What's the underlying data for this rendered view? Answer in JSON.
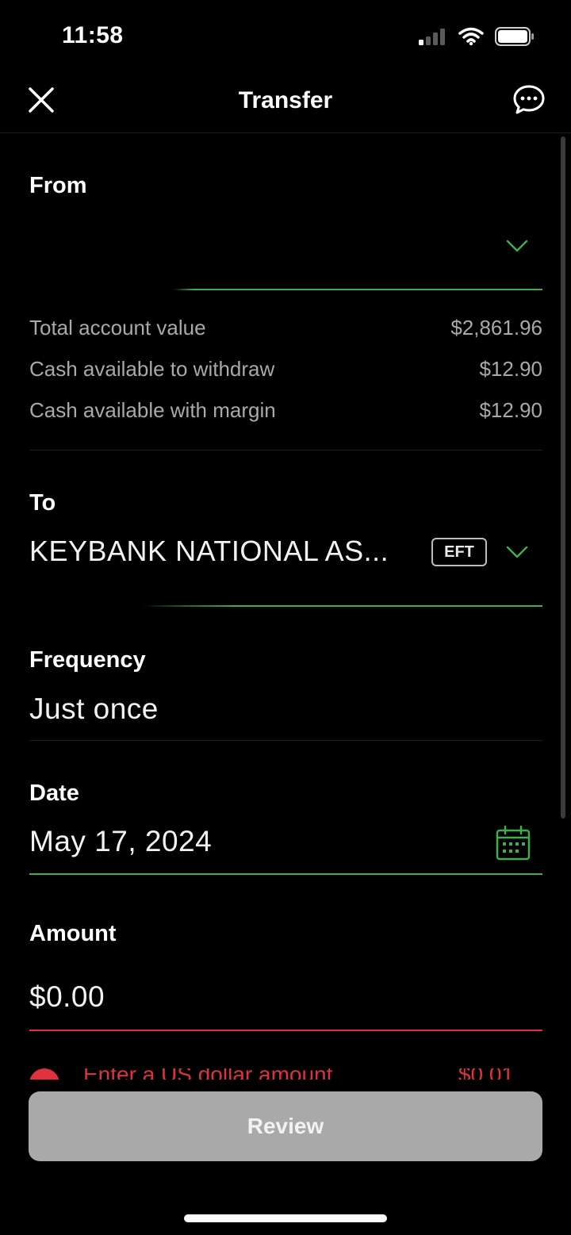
{
  "status_bar": {
    "time": "11:58"
  },
  "nav": {
    "title": "Transfer"
  },
  "from": {
    "label": "From",
    "account_value": "",
    "rows": [
      {
        "label": "Total account value",
        "value": "$2,861.96"
      },
      {
        "label": "Cash available to withdraw",
        "value": "$12.90"
      },
      {
        "label": "Cash available with margin",
        "value": "$12.90"
      }
    ]
  },
  "to": {
    "label": "To",
    "value": "KEYBANK NATIONAL AS...",
    "badge": "EFT"
  },
  "frequency": {
    "label": "Frequency",
    "value": "Just once"
  },
  "date": {
    "label": "Date",
    "value": "May 17, 2024"
  },
  "amount": {
    "label": "Amount",
    "value": "$0.00"
  },
  "error": {
    "text": "Enter a US dollar amount",
    "amount": "$0.01"
  },
  "review": {
    "label": "Review"
  },
  "colors": {
    "accent_green": "#3fae4e",
    "error_red": "#e0313f",
    "button_disabled": "#a9a9a9"
  }
}
